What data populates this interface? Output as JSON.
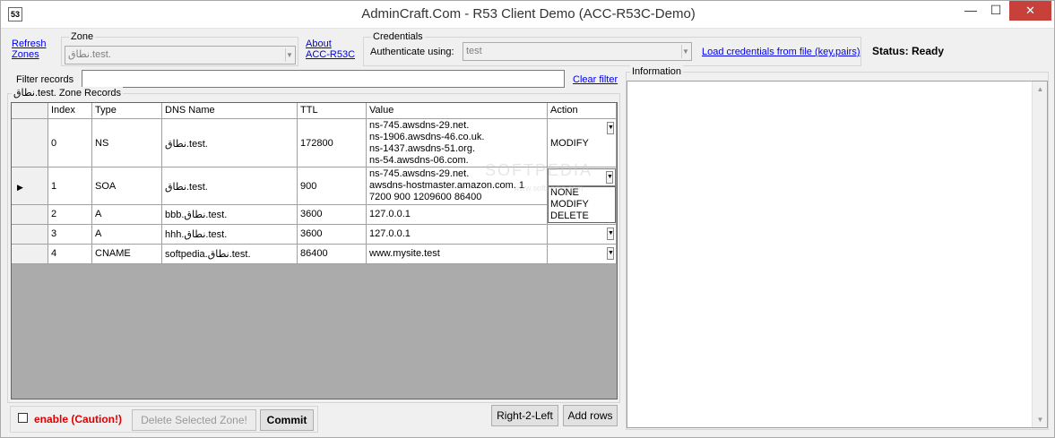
{
  "window": {
    "title": "AdminCraft.Com - R53 Client Demo (ACC-R53C-Demo)",
    "app_icon": "53"
  },
  "toolbar": {
    "refresh_link": [
      "Refresh",
      "Zones"
    ],
    "zone_group_label": "Zone",
    "zone_value": "نطاق.test.",
    "about_link": [
      "About",
      "ACC-R53C"
    ],
    "credentials_group_label": "Credentials",
    "authenticate_label": "Authenticate using:",
    "auth_value": "test",
    "load_link": "Load credentials from file (key.pairs)",
    "status": "Status:  Ready"
  },
  "filter": {
    "label": "Filter records",
    "value": "",
    "clear_link": "Clear filter"
  },
  "records_group_label": "نطاق.test. Zone Records",
  "grid": {
    "headers": [
      "Index",
      "Type",
      "DNS Name",
      "TTL",
      "Value",
      "Action"
    ],
    "rows": [
      {
        "index": "0",
        "type": "NS",
        "name": "نطاق.test.",
        "ttl": "172800",
        "value": [
          "ns-745.awsdns-29.net.",
          "ns-1906.awsdns-46.co.uk.",
          "ns-1437.awsdns-51.org.",
          "ns-54.awsdns-06.com."
        ],
        "action": "MODIFY"
      },
      {
        "index": "1",
        "type": "SOA",
        "name": "نطاق.test.",
        "ttl": "900",
        "value": [
          "ns-745.awsdns-29.net.",
          "awsdns-hostmaster.amazon.com. 1",
          "7200 900 1209600 86400"
        ],
        "action": ""
      },
      {
        "index": "2",
        "type": "A",
        "name": "bbb.نطاق.test.",
        "ttl": "3600",
        "value": [
          "127.0.0.1"
        ],
        "action": ""
      },
      {
        "index": "3",
        "type": "A",
        "name": "hhh.نطاق.test.",
        "ttl": "3600",
        "value": [
          "127.0.0.1"
        ],
        "action": ""
      },
      {
        "index": "4",
        "type": "CNAME",
        "name": "softpedia.نطاق.test.",
        "ttl": "86400",
        "value": [
          "www.mysite.test"
        ],
        "action": ""
      }
    ],
    "action_options": [
      "NONE",
      "MODIFY",
      "DELETE"
    ]
  },
  "info_group_label": "Information",
  "bottom": {
    "enable_label": "enable (Caution!)",
    "delete_zone_label": "Delete Selected Zone!",
    "commit_label": "Commit",
    "rtl_label": "Right-2-Left",
    "add_rows_label": "Add rows"
  },
  "watermark": {
    "main": "SOFTPEDIA",
    "sub": "www.softpedia.com"
  }
}
